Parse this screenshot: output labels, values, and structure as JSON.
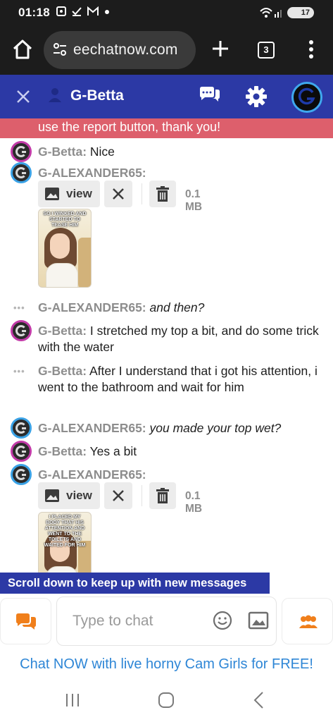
{
  "status_bar": {
    "time": "01:18",
    "notification_icons": [
      "screenshot-icon",
      "check-icon",
      "gmail-icon",
      "dot-icon"
    ],
    "battery_level": "17"
  },
  "browser": {
    "url": "eechatnow.com",
    "tab_count": "3",
    "icons": [
      "home-icon",
      "site-settings-icon",
      "plus-icon",
      "tabs-icon",
      "more-vert-icon"
    ]
  },
  "chat_header": {
    "title": "G-Betta",
    "icons": [
      "close-icon",
      "user-icon",
      "chat-bubbles-icon",
      "gear-icon",
      "avatar"
    ]
  },
  "banner": {
    "text": "use the report button, thank you!"
  },
  "messages": [
    {
      "user": "G-Betta:",
      "text": "Nice",
      "italic": false,
      "avatar": "female"
    },
    {
      "user": "G-ALEXANDER65:",
      "text": "",
      "italic": false,
      "avatar": "male",
      "attachment": {
        "view_label": "view",
        "size": "0.1 MB",
        "image_caption": "SO I WINKED AND STARTED TO TEASE HIM"
      }
    },
    {
      "user": "G-ALEXANDER65:",
      "text": "and then?",
      "italic": true,
      "avatar": "dots"
    },
    {
      "user": "G-Betta:",
      "text": "I stretched my top a bit, and do some trick with the water",
      "italic": false,
      "avatar": "female"
    },
    {
      "user": "G-Betta:",
      "text": "After I understand that i got his attention, i went to the bathroom and wait for him",
      "italic": false,
      "avatar": "dots"
    },
    {
      "user": "G-ALEXANDER65:",
      "text": "you made your top wet?",
      "italic": true,
      "avatar": "male"
    },
    {
      "user": "G-Betta:",
      "text": "Yes a bit",
      "italic": false,
      "avatar": "female"
    },
    {
      "user": "G-ALEXANDER65:",
      "text": "",
      "italic": false,
      "avatar": "male",
      "attachment": {
        "view_label": "view",
        "size": "0.1 MB",
        "image_caption": "I PLACED MY BODY THAT HIS ATTENTION AND WENT TO THE TOILETS AND WAITED FOR HIM"
      }
    }
  ],
  "scroll_notice": "Scroll down to keep up with new messages",
  "input": {
    "placeholder": "Type to chat",
    "value": ""
  },
  "promo": "Chat NOW with live horny Cam Girls for FREE!",
  "colors": {
    "header_blue": "#2c39a5",
    "banner_red": "#dd5f6c",
    "username_gray": "#8d8d8d",
    "female_ring": "#c23aa8",
    "male_ring": "#3aa2e6",
    "accent_orange": "#f07f1b",
    "promo_link": "#2e86d6"
  }
}
